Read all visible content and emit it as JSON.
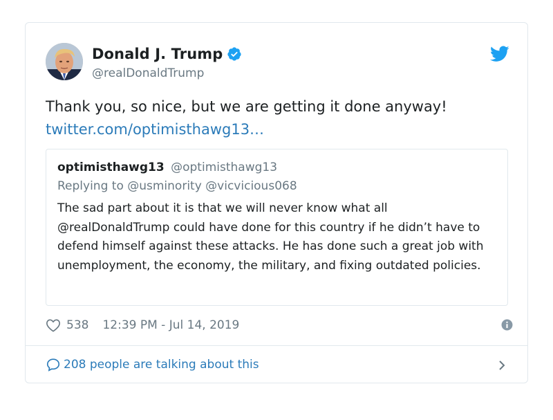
{
  "author": {
    "display_name": "Donald J. Trump",
    "handle": "@realDonaldTrump",
    "verified": true
  },
  "tweet": {
    "text": "Thank you, so nice, but we are getting it done anyway!",
    "link": "twitter.com/optimisthawg13…"
  },
  "quoted_tweet": {
    "display_name": "optimisthawg13",
    "handle": "@optimisthawg13",
    "replying_to": "Replying to @usminority @vicvicious068",
    "text": "The sad part about it is that we will never know what all @realDonaldTrump could have done for this country if he didn’t have to defend himself against these attacks. He has done such a great job with unemployment, the economy, the military, and fixing outdated policies."
  },
  "footer": {
    "likes": "538",
    "timestamp": "12:39 PM - Jul 14, 2019",
    "talking": "208 people are talking about this"
  },
  "colors": {
    "brand_blue": "#1da1f2",
    "link_blue": "#2b7bb9",
    "text": "#1c2022",
    "secondary": "#697882",
    "border": "#e1e8ed"
  },
  "icons": {
    "bird": "twitter-bird-icon",
    "verified": "verified-badge-icon",
    "like": "heart-icon",
    "info": "info-icon",
    "comment": "speech-bubble-icon",
    "chevron": "chevron-right-icon"
  }
}
